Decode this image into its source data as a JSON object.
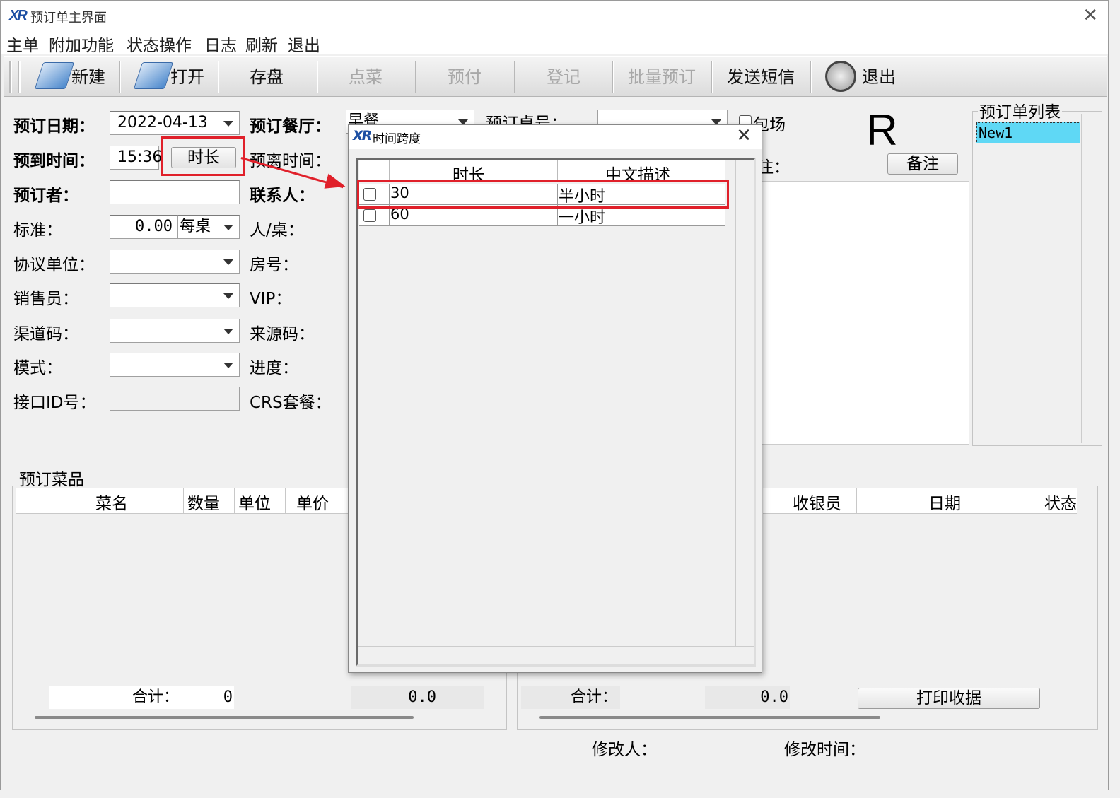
{
  "window": {
    "title": "预订单主界面",
    "logo_text": "XR"
  },
  "menu": [
    "主单",
    "附加功能",
    "状态操作",
    "日志",
    "刷新",
    "退出"
  ],
  "toolbar": {
    "new": "新建",
    "open": "打开",
    "save": "存盘",
    "order_dish": "点菜",
    "prepay": "预付",
    "register": "登记",
    "batch_book": "批量预订",
    "send_sms": "发送短信",
    "exit": "退出"
  },
  "form": {
    "booking_date_label": "预订日期：",
    "booking_date_value": "2022-04-13",
    "arrival_time_label": "预到时间：",
    "arrival_time_value": "15:36",
    "duration_button": "时长",
    "booker_label": "预订者：",
    "standard_label": "标准：",
    "standard_value": "0.00",
    "standard_unit": "每桌",
    "agreement_label": "协议单位：",
    "sales_label": "销售员：",
    "channel_label": "渠道码：",
    "mode_label": "模式：",
    "interface_label": "接口ID号：",
    "restaurant_label": "预订餐厅：",
    "restaurant_value": "早餐",
    "leave_time_label": "预离时间：",
    "contact_label": "联系人：",
    "per_table_label": "人/桌：",
    "room_label": "房号：",
    "vip_label": "VIP：",
    "source_label": "来源码：",
    "progress_label": "进度：",
    "crs_label": "CRS套餐：",
    "table_no_label": "预订桌号：",
    "private_label": "包场",
    "remark_label": "注：",
    "remark_button": "备注",
    "big_letter": "R"
  },
  "order_list": {
    "title": "预订单列表",
    "items": [
      "New1"
    ]
  },
  "dishes": {
    "title": "预订菜品",
    "columns": [
      "菜名",
      "数量",
      "单位",
      "单价"
    ],
    "total_label": "合计：",
    "total_qty": "0",
    "total_amount": "0.0"
  },
  "payments": {
    "columns": [
      "收银员",
      "日期",
      "状态"
    ],
    "total_label": "合计：",
    "total_amount": "0.0",
    "print_button": "打印收据"
  },
  "footer": {
    "modifier_label": "修改人：",
    "modify_time_label": "修改时间："
  },
  "dialog": {
    "title": "时间跨度",
    "columns": [
      "时长",
      "中文描述"
    ],
    "rows": [
      {
        "duration": "30",
        "desc": "半小时"
      },
      {
        "duration": "60",
        "desc": "一小时"
      }
    ]
  },
  "colors": {
    "highlight_red": "#e0202a",
    "list_selected": "#5fd8f5",
    "brand_blue": "#1c4fa3"
  }
}
